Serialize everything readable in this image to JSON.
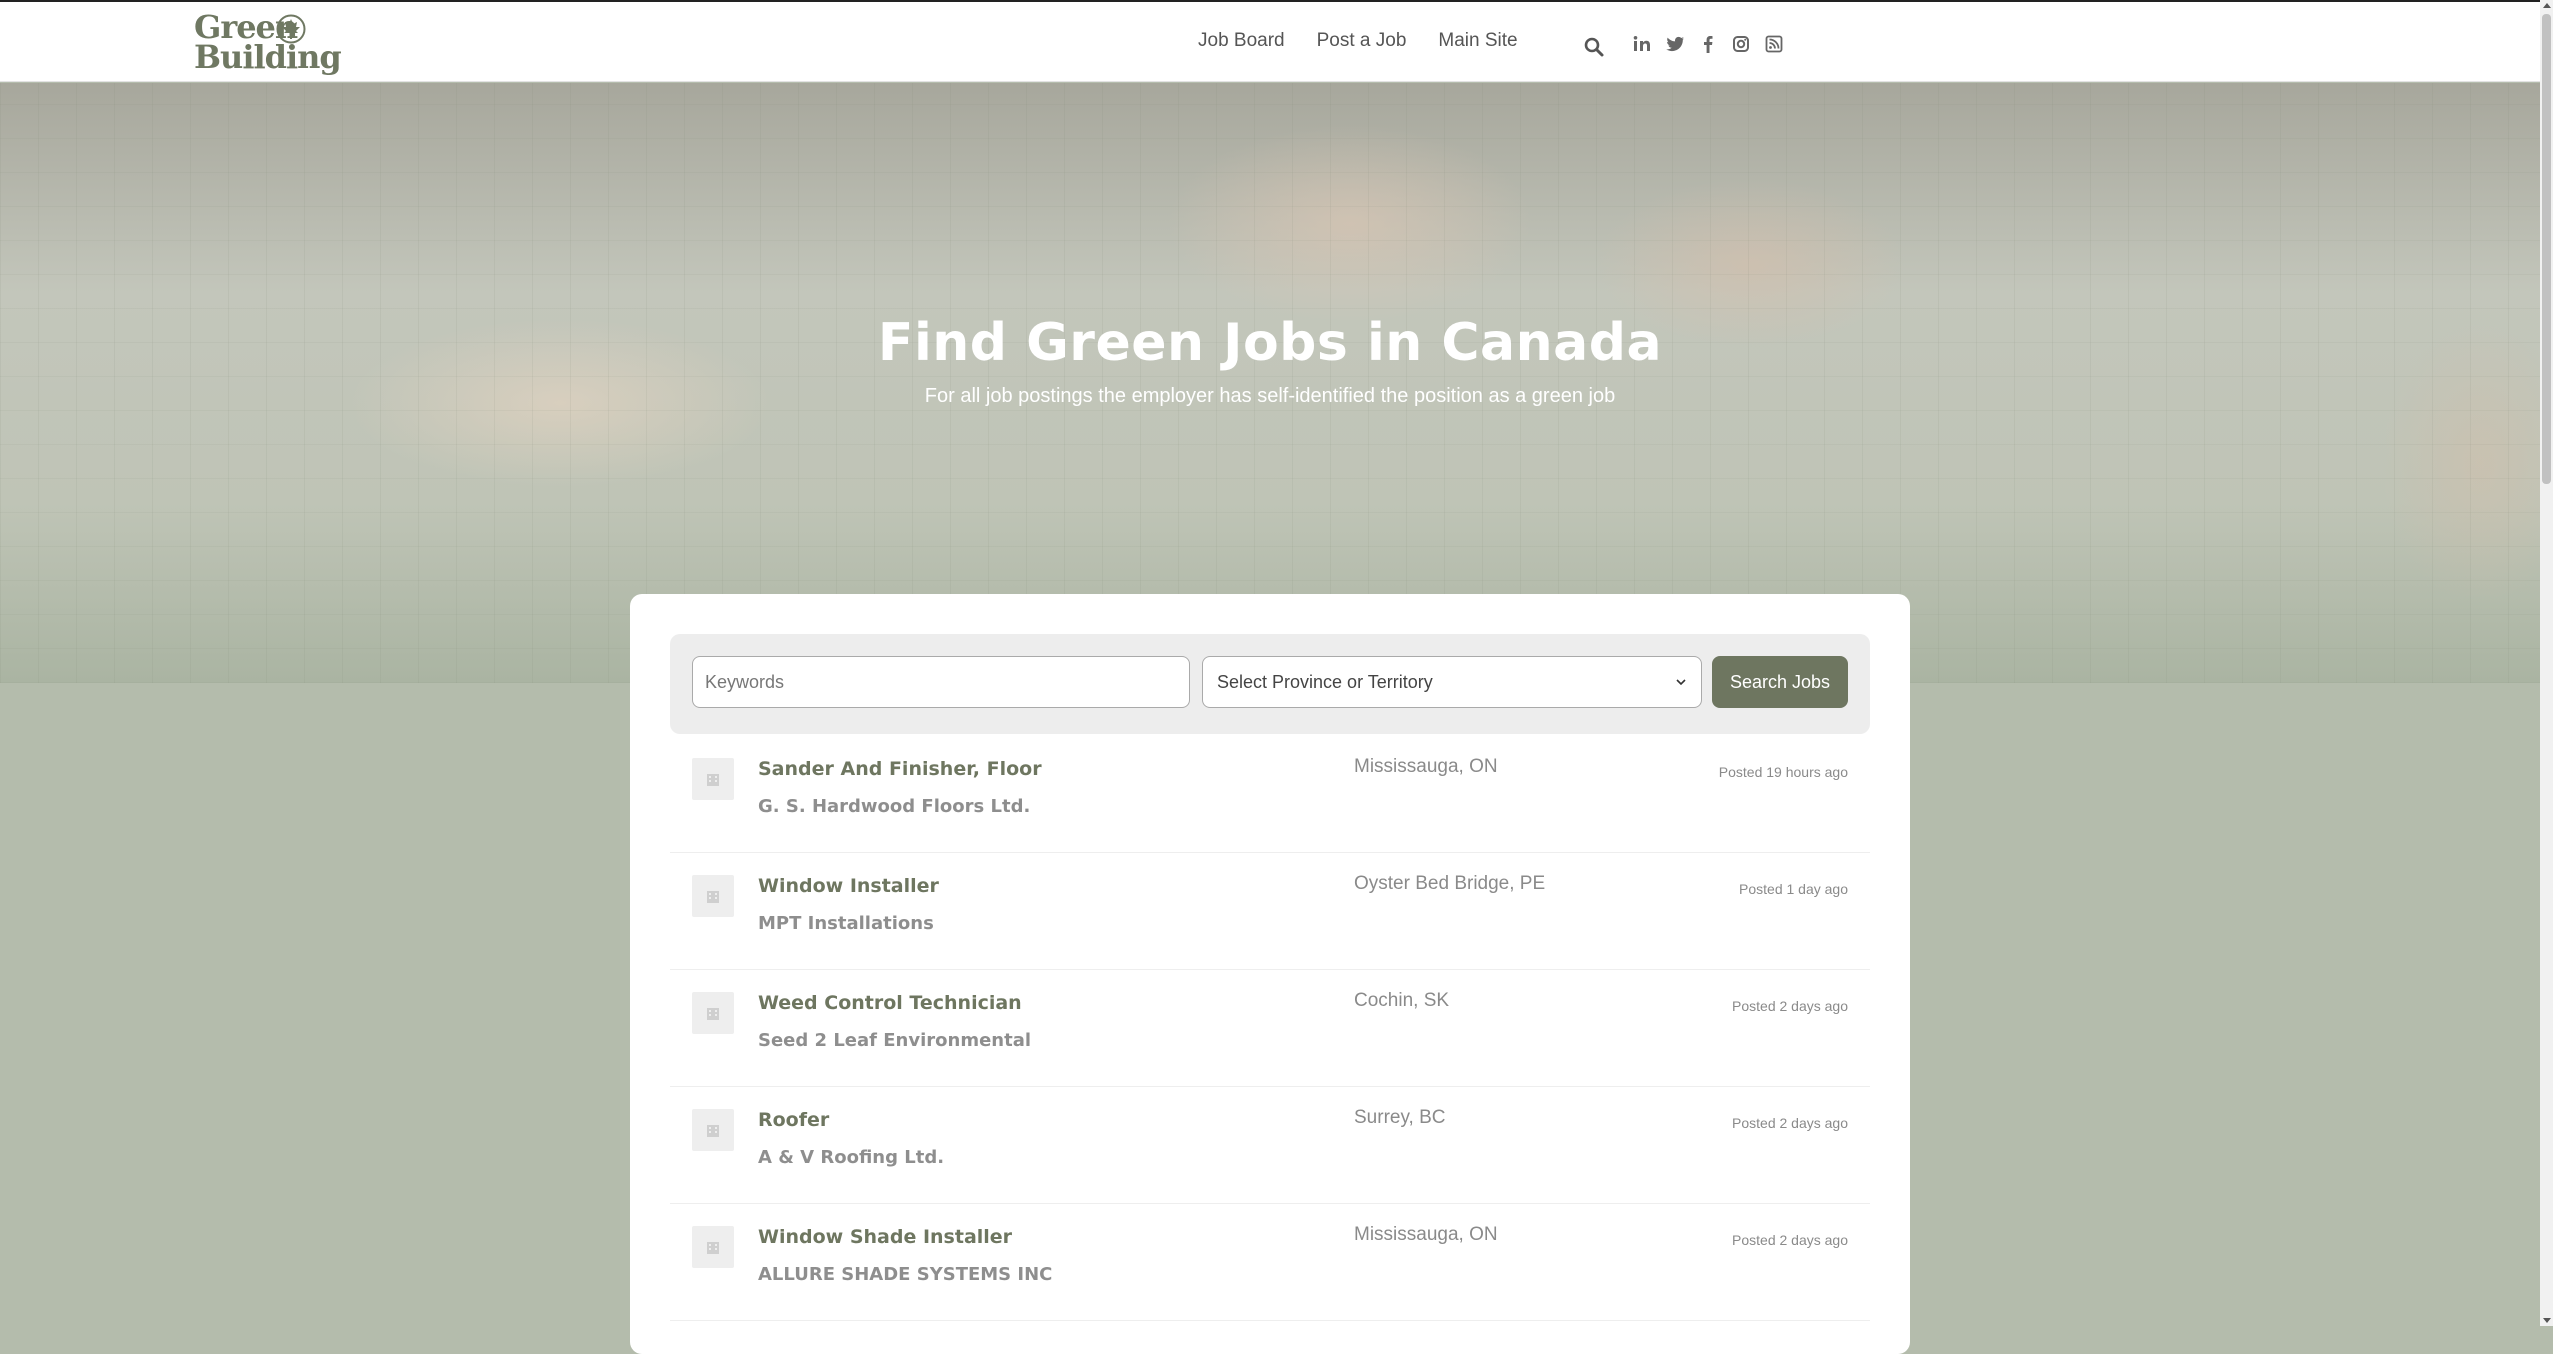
{
  "header": {
    "logo": {
      "line1": "Green",
      "line2": "Building",
      "icon": "maple-leaf-icon"
    },
    "nav": [
      {
        "label": "Job Board"
      },
      {
        "label": "Post a Job"
      },
      {
        "label": "Main Site"
      }
    ],
    "search_icon": "search-icon",
    "socials": [
      "linkedin-icon",
      "twitter-icon",
      "facebook-icon",
      "instagram-icon",
      "rss-icon"
    ]
  },
  "hero": {
    "title": "Find Green Jobs in Canada",
    "subtitle": "For all job postings the employer has self-identified the position as a green job"
  },
  "search": {
    "keywords_placeholder": "Keywords",
    "province_selected": "Select Province or Territory",
    "button_label": "Search Jobs"
  },
  "jobs": [
    {
      "title": "Sander And Finisher, Floor",
      "company": "G. S. Hardwood Floors Ltd.",
      "location": "Mississauga, ON",
      "posted": "Posted 19 hours ago"
    },
    {
      "title": "Window Installer",
      "company": "MPT Installations",
      "location": "Oyster Bed Bridge, PE",
      "posted": "Posted 1 day ago"
    },
    {
      "title": "Weed Control Technician",
      "company": "Seed 2 Leaf Environmental",
      "location": "Cochin, SK",
      "posted": "Posted 2 days ago"
    },
    {
      "title": "Roofer",
      "company": "A & V Roofing Ltd.",
      "location": "Surrey, BC",
      "posted": "Posted 2 days ago"
    },
    {
      "title": "Window Shade Installer",
      "company": "ALLURE SHADE SYSTEMS INC",
      "location": "Mississauga, ON",
      "posted": "Posted 2 days ago"
    }
  ],
  "colors": {
    "accent": "#6e7660",
    "page_bg": "#b4bcac",
    "muted_text": "#8a8a8a"
  }
}
